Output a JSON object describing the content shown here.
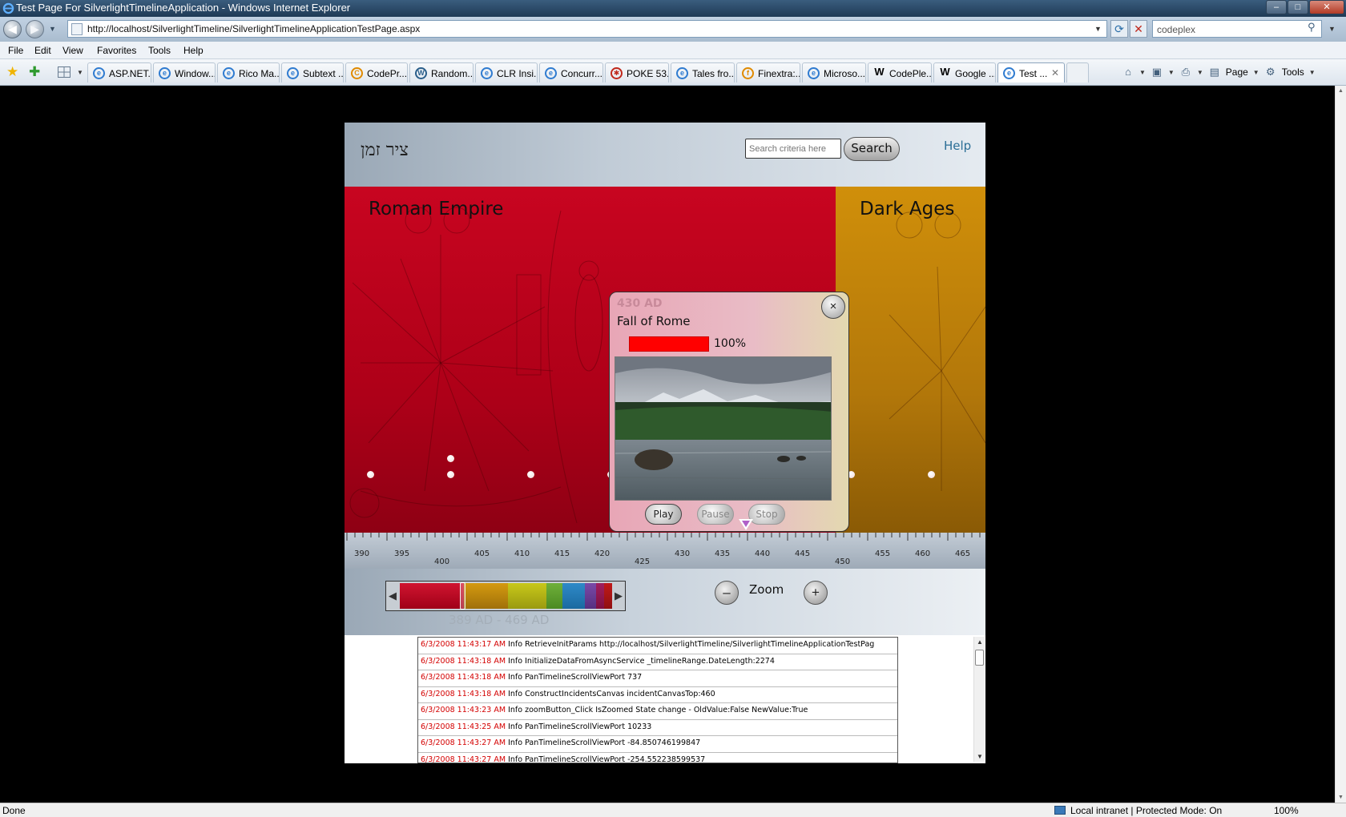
{
  "window": {
    "title": "Test Page For SilverlightTimelineApplication - Windows Internet Explorer",
    "min": "–",
    "max": "□",
    "close": "✕"
  },
  "address_bar": {
    "url": "http://localhost/SilverlightTimeline/SilverlightTimelineApplicationTestPage.aspx",
    "search_value": "codeplex"
  },
  "menu": [
    "File",
    "Edit",
    "View",
    "Favorites",
    "Tools",
    "Help"
  ],
  "tabs": [
    {
      "label": "ASP.NET..."
    },
    {
      "label": "Window..."
    },
    {
      "label": "Rico Ma..."
    },
    {
      "label": "Subtext ..."
    },
    {
      "label": "CodePr..."
    },
    {
      "label": "Random..."
    },
    {
      "label": "CLR Insi..."
    },
    {
      "label": "Concurr..."
    },
    {
      "label": "POKE 53..."
    },
    {
      "label": "Tales fro..."
    },
    {
      "label": "Finextra:..."
    },
    {
      "label": "Microso..."
    },
    {
      "label": "CodePle..."
    },
    {
      "label": "Google ..."
    },
    {
      "label": "Test ..."
    }
  ],
  "command_bar": {
    "page": "Page",
    "tools": "Tools"
  },
  "app": {
    "logo": "ציר זמן",
    "search_placeholder": "Search criteria here",
    "search_button": "Search",
    "help": "Help",
    "eras": [
      {
        "name": "Roman Empire",
        "color": "#c00520"
      },
      {
        "name": "Dark Ages",
        "color": "#c7880b"
      }
    ],
    "ruler_ticks": [
      "390",
      "395",
      "400",
      "405",
      "410",
      "415",
      "420",
      "425",
      "430",
      "435",
      "440",
      "445",
      "450",
      "455",
      "460",
      "465"
    ],
    "overview_range": "389 AD - 469 AD",
    "zoom_label": "Zoom",
    "zoom_out": "–",
    "zoom_in": "+"
  },
  "popup": {
    "date": "430 AD",
    "title": "Fall of Rome",
    "progress_percent": 100,
    "progress_label": "100%",
    "close": "×",
    "buttons": {
      "play": "Play",
      "pause": "Pause",
      "stop": "Stop"
    }
  },
  "log": [
    {
      "time": "6/3/2008 11:43:17 AM",
      "text": "Info RetrieveInitParams http://localhost/SilverlightTimeline/SilverlightTimelineApplicationTestPag"
    },
    {
      "time": "6/3/2008 11:43:18 AM",
      "text": "Info InitializeDataFromAsyncService _timelineRange.DateLength:2274"
    },
    {
      "time": "6/3/2008 11:43:18 AM",
      "text": "Info PanTimelineScrollViewPort 737"
    },
    {
      "time": "6/3/2008 11:43:18 AM",
      "text": "Info ConstructIncidentsCanvas incidentCanvasTop:460"
    },
    {
      "time": "6/3/2008 11:43:23 AM",
      "text": "Info zoomButton_Click IsZoomed State change -  OldValue:False NewValue:True"
    },
    {
      "time": "6/3/2008 11:43:25 AM",
      "text": "Info PanTimelineScrollViewPort 10233"
    },
    {
      "time": "6/3/2008 11:43:27 AM",
      "text": "Info PanTimelineScrollViewPort -84.850746199847"
    },
    {
      "time": "6/3/2008 11:43:27 AM",
      "text": "Info PanTimelineScrollViewPort -254.552238599537"
    }
  ],
  "status": {
    "text": "Done",
    "zone": "Local intranet | Protected Mode: On",
    "zoom": "100%"
  }
}
